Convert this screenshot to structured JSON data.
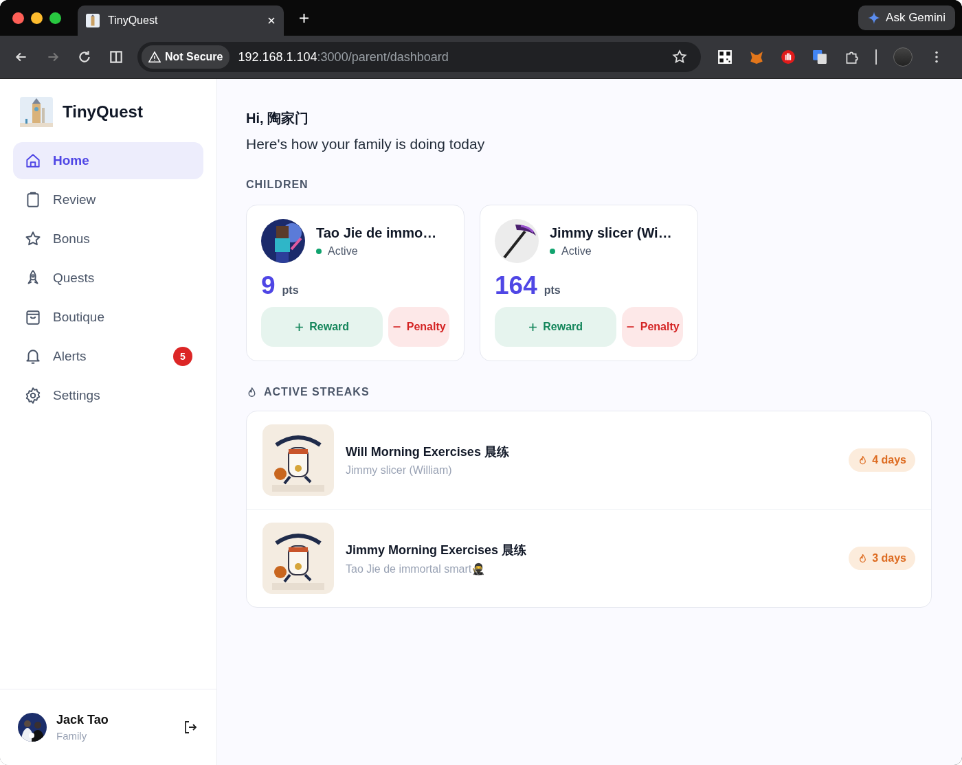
{
  "browser": {
    "tab_title": "TinyQuest",
    "ask_button": "Ask Gemini",
    "security": "Not Secure",
    "url_host": "192.168.1.104",
    "url_path": ":3000/parent/dashboard"
  },
  "sidebar": {
    "app_name": "TinyQuest",
    "items": [
      {
        "label": "Home",
        "selected": true
      },
      {
        "label": "Review",
        "selected": false
      },
      {
        "label": "Bonus",
        "selected": false
      },
      {
        "label": "Quests",
        "selected": false
      },
      {
        "label": "Boutique",
        "selected": false
      },
      {
        "label": "Alerts",
        "selected": false,
        "badge": "5"
      },
      {
        "label": "Settings",
        "selected": false
      }
    ],
    "user": {
      "name": "Jack Tao",
      "role": "Family"
    }
  },
  "greeting": "Hi, 陶家门",
  "subtitle": "Here's how your family is doing today",
  "children_heading": "CHILDREN",
  "children": [
    {
      "name": "Tao Jie de immo…",
      "status": "Active",
      "color": "#10a36e",
      "points": "9",
      "unit": "pts",
      "reward": "Reward",
      "penalty": "Penalty"
    },
    {
      "name": "Jimmy slicer (Wi…",
      "status": "Active",
      "color": "#10a36e",
      "points": "164",
      "unit": "pts",
      "reward": "Reward",
      "penalty": "Penalty"
    }
  ],
  "streaks_heading": "ACTIVE STREAKS",
  "streaks": [
    {
      "title": "Will Morning Exercises 晨练",
      "child": "Jimmy slicer (William)",
      "days": "4 days"
    },
    {
      "title": "Jimmy Morning Exercises 晨练",
      "child": "Tao Jie de immortal smart🥷",
      "days": "3 days"
    }
  ]
}
